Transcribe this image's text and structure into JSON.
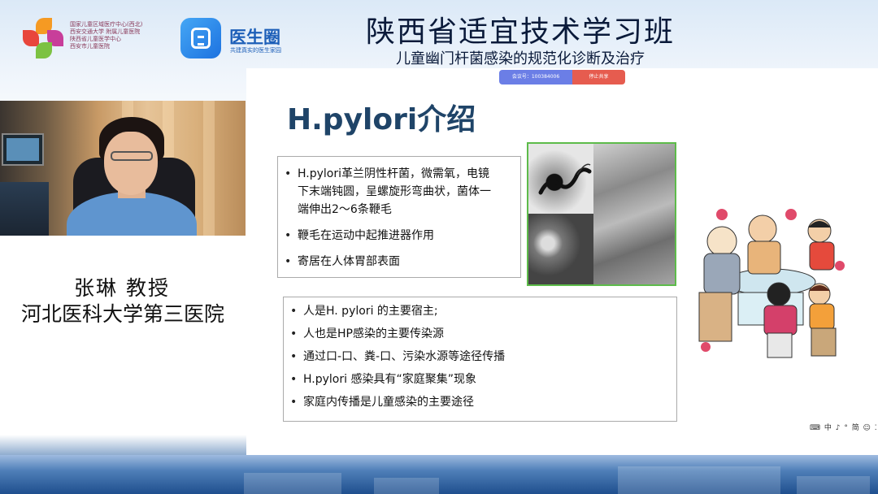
{
  "header": {
    "org_logo_lines": [
      "国家儿童区域医疗中心(西北)",
      "西安交通大学 附属儿童医院",
      "陕西省儿童医学中心",
      "西安市儿童医院"
    ],
    "platform_name": "医生圈",
    "platform_slogan": "共建真实的医生家园",
    "course_title": "陕西省适宜技术学习班",
    "course_subtitle": "儿童幽门杆菌感染的规范化诊断及治疗"
  },
  "speaker": {
    "name": "张琳  教授",
    "institution": "河北医科大学第三医院"
  },
  "share_bar": {
    "meeting_id": "会议号：100384006",
    "stop_label": "停止共享"
  },
  "slide": {
    "title": "H.pylori介绍",
    "box1_bullets": [
      "H.pylori革兰阴性杆菌，微需氧，电镜",
      "下末端钝圆，呈螺旋形弯曲状，菌体一",
      "端伸出2～6条鞭毛",
      "鞭毛在运动中起推进器作用",
      "寄居在人体胃部表面"
    ],
    "box2_bullets": [
      "人是H. pylori 的主要宿主;",
      "人也是HP感染的主要传染源",
      "通过口-口、粪-口、污染水源等途径传播",
      "H.pylori 感染具有“家庭聚集”现象",
      "家庭内传播是儿童感染的主要途径"
    ]
  },
  "tray": {
    "text": "中 ♪ ° 简 ☺ ⁚"
  },
  "colors": {
    "slide_title": "#1f4468",
    "micro_border": "#5dbb4a",
    "meet_bar": "#6b7ee6",
    "stop_bar": "#e65c4f"
  }
}
